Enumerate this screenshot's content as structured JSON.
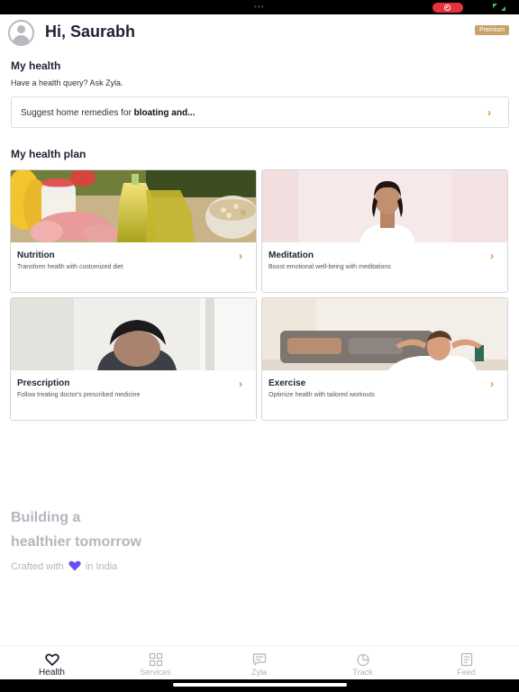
{
  "status_bar": {
    "dots": "•••"
  },
  "header": {
    "greeting": "Hi, Saurabh",
    "badge": "Premium"
  },
  "my_health": {
    "title": "My health",
    "subtitle": "Have a health query? Ask Zyla.",
    "query_prefix": "Suggest home remedies for ",
    "query_bold": "bloating and..."
  },
  "health_plan": {
    "title": "My health plan",
    "cards": [
      {
        "title": "Nutrition",
        "desc": "Transform health with customized diet"
      },
      {
        "title": "Meditation",
        "desc": "Boost emotional well-being with meditations"
      },
      {
        "title": "Prescription",
        "desc": "Follow treating doctor's prescribed medicine"
      },
      {
        "title": "Exercise",
        "desc": "Optimize health with tailored workouts"
      }
    ]
  },
  "footer": {
    "line1": "Building a",
    "line2": "healthier tomorrow",
    "crafted_prefix": "Crafted with",
    "crafted_suffix": "in India",
    "heart_color": "#6c4ff0"
  },
  "tabs": [
    {
      "label": "Health",
      "icon": "heart-icon",
      "active": true
    },
    {
      "label": "Services",
      "icon": "grid-icon",
      "active": false
    },
    {
      "label": "Zyla",
      "icon": "chat-icon",
      "active": false
    },
    {
      "label": "Track",
      "icon": "pie-chart-icon",
      "active": false
    },
    {
      "label": "Feed",
      "icon": "document-icon",
      "active": false
    }
  ],
  "colors": {
    "accent_orange": "#e08a2c",
    "premium_gold": "#c9a46a",
    "heading_navy": "#1e2236",
    "record_red": "#e5323b"
  }
}
